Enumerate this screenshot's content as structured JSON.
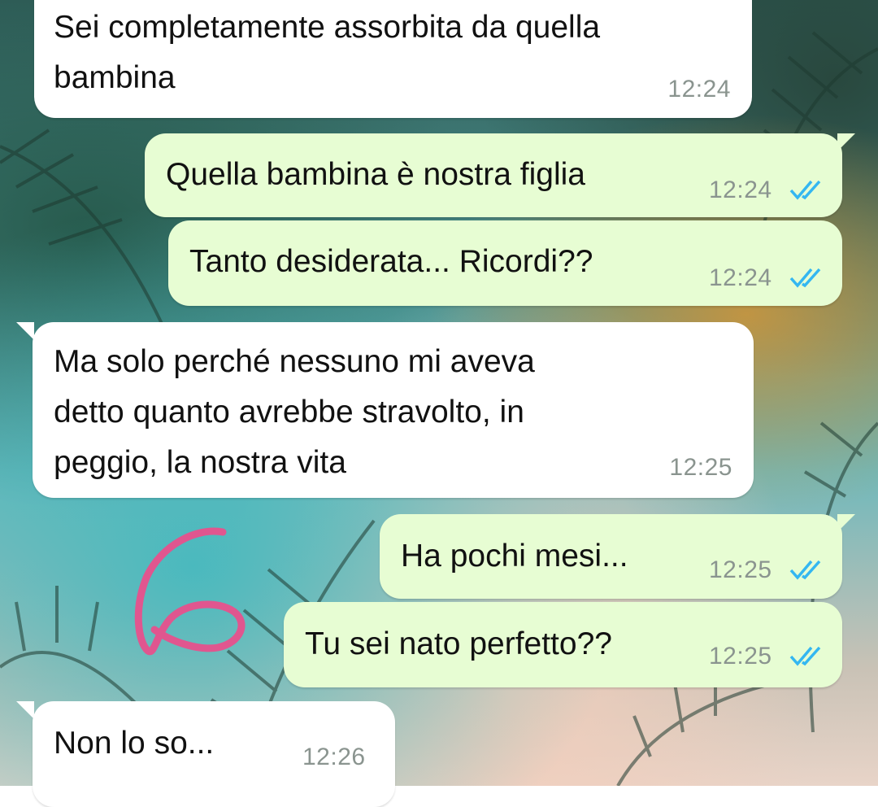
{
  "messages": [
    {
      "direction": "incoming",
      "text": "Sei completamente assorbita da quella\nbambina",
      "time": "12:24"
    },
    {
      "direction": "outgoing",
      "text": "Quella bambina è nostra figlia",
      "time": "12:24",
      "status": "read"
    },
    {
      "direction": "outgoing",
      "text": "Tanto desiderata... Ricordi??",
      "time": "12:24",
      "status": "read"
    },
    {
      "direction": "incoming",
      "text": "Ma solo perché nessuno mi aveva\ndetto quanto avrebbe stravolto, in\npeggio, la nostra vita",
      "time": "12:25"
    },
    {
      "direction": "outgoing",
      "text": "Ha pochi mesi...",
      "time": "12:25",
      "status": "read"
    },
    {
      "direction": "outgoing",
      "text": "Tu sei nato perfetto??",
      "time": "12:25",
      "status": "read"
    },
    {
      "direction": "incoming",
      "text": "Non lo so...",
      "time": "12:26"
    }
  ],
  "icons": {
    "read_receipt": "double-check-icon",
    "annotation": "handwritten-six-doodle"
  },
  "colors": {
    "incoming_bubble": "#ffffff",
    "outgoing_bubble": "#e7fdd3",
    "read_ticks": "#34b7f1",
    "doodle": "#e0568f",
    "timestamp": "#8a948f"
  }
}
